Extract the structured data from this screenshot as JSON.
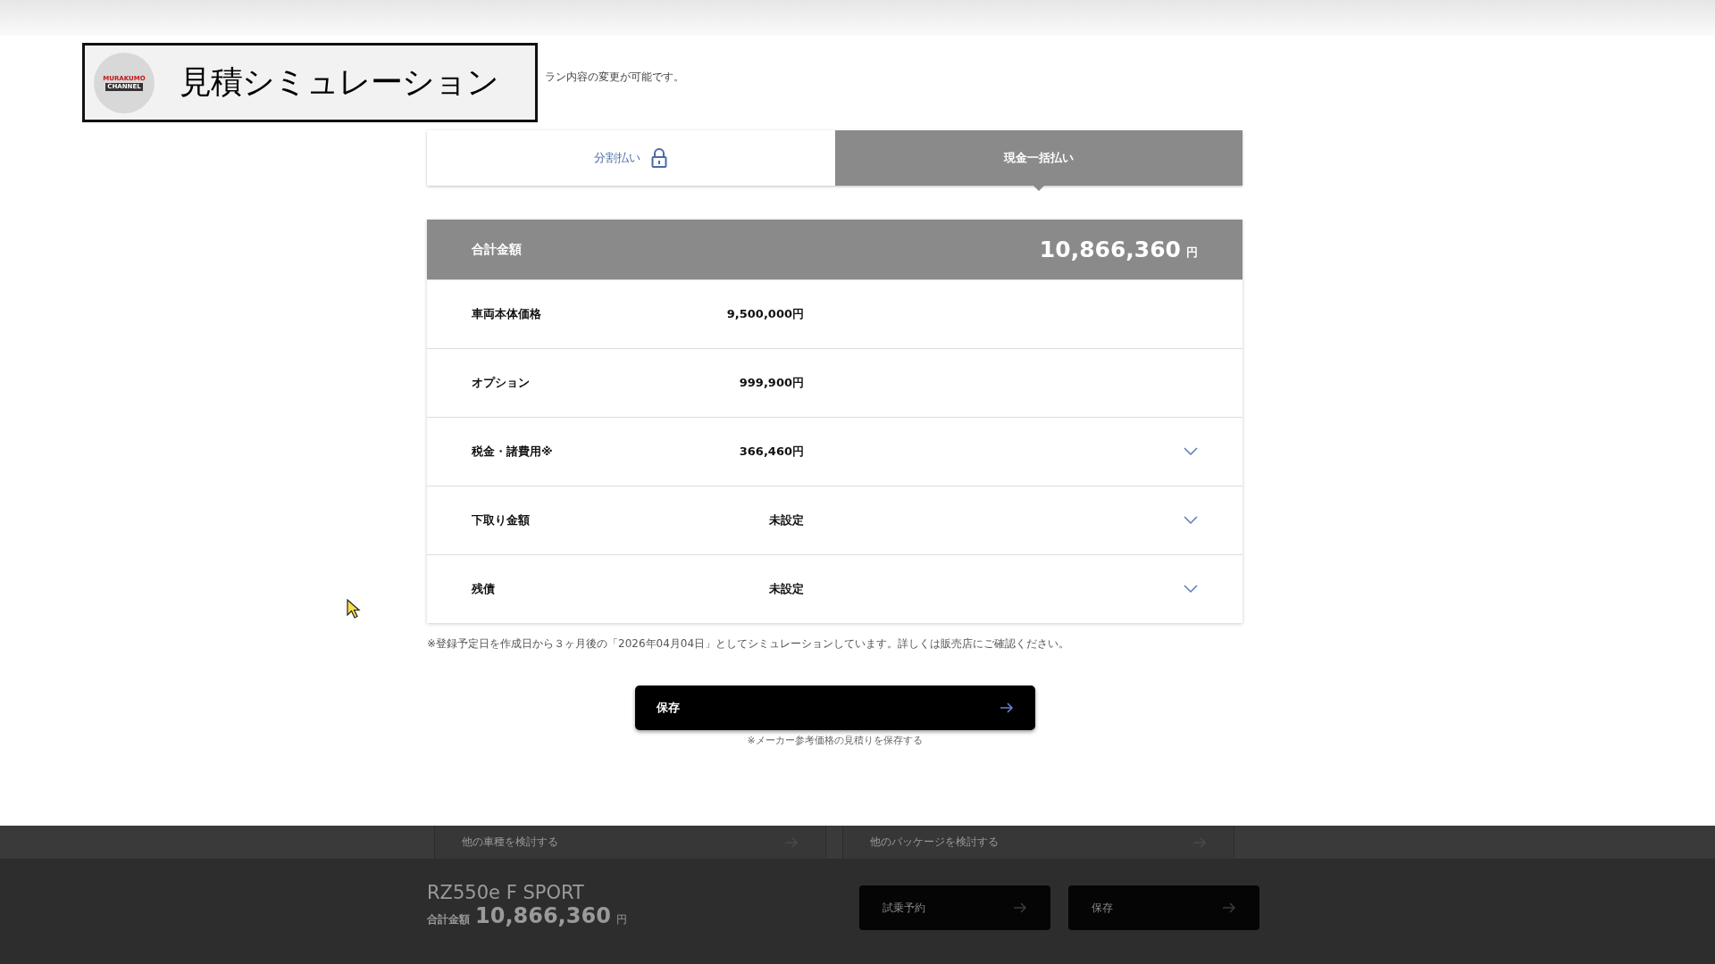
{
  "overlay_title": {
    "logo_lines": [
      "MURAKUMO",
      "CHANNEL"
    ],
    "text": "見積シミュレーション"
  },
  "subtitle": "ラン内容の変更が可能です。",
  "tabs": [
    {
      "label": "分割払い",
      "locked": true,
      "selected": false
    },
    {
      "label": "現金一括払い",
      "locked": false,
      "selected": true
    }
  ],
  "summary": {
    "total_label": "合計金額",
    "total_value": "10,866,360",
    "total_unit": "円",
    "rows": [
      {
        "label": "車両本体価格",
        "value": "9,500,000円",
        "expandable": false
      },
      {
        "label": "オプション",
        "value": "999,900円",
        "expandable": false
      },
      {
        "label": "税金・諸費用※",
        "value": "366,460円",
        "expandable": true
      },
      {
        "label": "下取り金額",
        "value": "未設定",
        "expandable": true
      },
      {
        "label": "残債",
        "value": "未設定",
        "expandable": true
      }
    ]
  },
  "footnote": "※登録予定日を作成日から３ヶ月後の「2026年04月04日」としてシミュレーションしています。詳しくは販売店にご確認ください。",
  "save_button": {
    "label": "保存",
    "note": "※メーカー参考価格の見積りを保存する"
  },
  "footer_links": [
    "他の車種を検討する",
    "他のパッケージを検討する"
  ],
  "bottom_bar": {
    "model": "RZ550e F SPORT",
    "total_label": "合計金額",
    "total_value": "10,866,360",
    "total_unit": "円",
    "buttons": [
      "試乗予約",
      "保存"
    ]
  }
}
